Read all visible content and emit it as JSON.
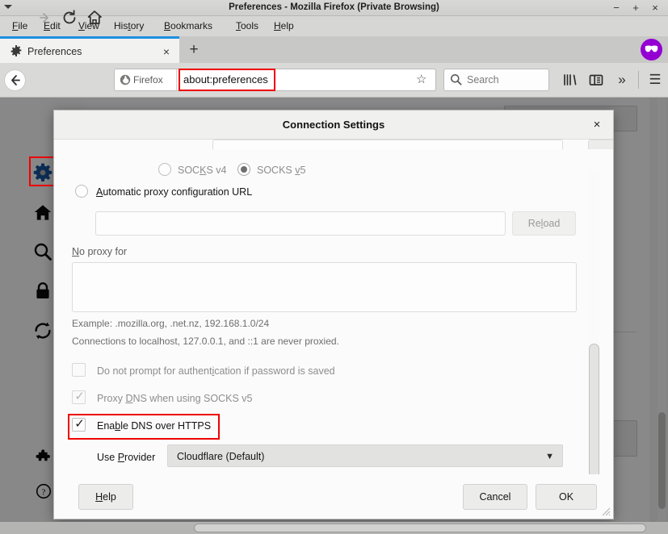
{
  "window": {
    "title": "Preferences - Mozilla Firefox (Private Browsing)",
    "minimize": "−",
    "maximize": "+",
    "close": "×"
  },
  "menubar": {
    "items": [
      {
        "label": "File",
        "accel": "F"
      },
      {
        "label": "Edit",
        "accel": "E"
      },
      {
        "label": "View",
        "accel": "V"
      },
      {
        "label": "History",
        "accel": "t"
      },
      {
        "label": "Bookmarks",
        "accel": "B"
      },
      {
        "label": "Tools",
        "accel": "T"
      },
      {
        "label": "Help",
        "accel": "H"
      }
    ]
  },
  "tabs": {
    "active": {
      "label": "Preferences",
      "close": "×",
      "favicon": "gear-icon"
    },
    "new_tab": "+",
    "private_indicator": "private-browsing-mask-icon"
  },
  "toolbar": {
    "back": "back-arrow-icon",
    "forward": "forward-arrow-icon",
    "reload": "reload-icon",
    "home": "home-icon",
    "identity_label": "Firefox",
    "url_value": "about:preferences",
    "bookmark_star": "☆",
    "search_placeholder": "Search",
    "library": "library-icon",
    "sidebar": "sidebar-icon",
    "overflow": "»",
    "menu": "☰"
  },
  "sidebar": {
    "items": [
      {
        "name": "general",
        "icon": "gear-icon",
        "selected": true
      },
      {
        "name": "home",
        "icon": "home-icon",
        "selected": false
      },
      {
        "name": "search",
        "icon": "search-icon",
        "selected": false
      },
      {
        "name": "privacy",
        "icon": "lock-icon",
        "selected": false
      },
      {
        "name": "sync",
        "icon": "sync-icon",
        "selected": false
      },
      {
        "name": "extensions",
        "icon": "puzzle-icon",
        "selected": false
      },
      {
        "name": "support",
        "icon": "help-icon",
        "selected": false
      }
    ]
  },
  "dialog": {
    "title": "Connection Settings",
    "close": "×",
    "socks": {
      "v4": {
        "label": "SOCKS v4",
        "accel": "K",
        "checked": false
      },
      "v5": {
        "label": "SOCKS v5",
        "accel": "v",
        "checked": true
      }
    },
    "pac": {
      "label": "Automatic proxy configuration URL",
      "accel": "A",
      "checked": false,
      "url_value": "",
      "reload_label": "Reload",
      "reload_accel": "l",
      "reload_disabled": true
    },
    "no_proxy": {
      "label": "No proxy for",
      "accel": "N",
      "value": "",
      "example": "Example: .mozilla.org, .net.nz, 192.168.1.0/24",
      "note": "Connections to localhost, 127.0.0.1, and ::1 are never proxied."
    },
    "checkboxes": [
      {
        "label": "Do not prompt for authentication if password is saved",
        "accel": "i",
        "checked": false,
        "disabled": true,
        "highlighted": false
      },
      {
        "label": "Proxy DNS when using SOCKS v5",
        "accel": "D",
        "checked": true,
        "disabled": true,
        "highlighted": false
      },
      {
        "label": "Enable DNS over HTTPS",
        "accel": "b",
        "checked": true,
        "disabled": false,
        "highlighted": true
      }
    ],
    "provider": {
      "label": "Use Provider",
      "accel": "P",
      "value": "Cloudflare (Default)",
      "chevron": "⌄"
    },
    "buttons": {
      "help": {
        "label": "Help",
        "accel": "H"
      },
      "cancel": {
        "label": "Cancel",
        "accel": ""
      },
      "ok": {
        "label": "OK",
        "accel": ""
      }
    }
  },
  "colors": {
    "accent_blue": "#1f8fe0",
    "highlight_red": "#ee0000",
    "gear_blue": "#15539e",
    "private_purple": "#9400d3"
  }
}
